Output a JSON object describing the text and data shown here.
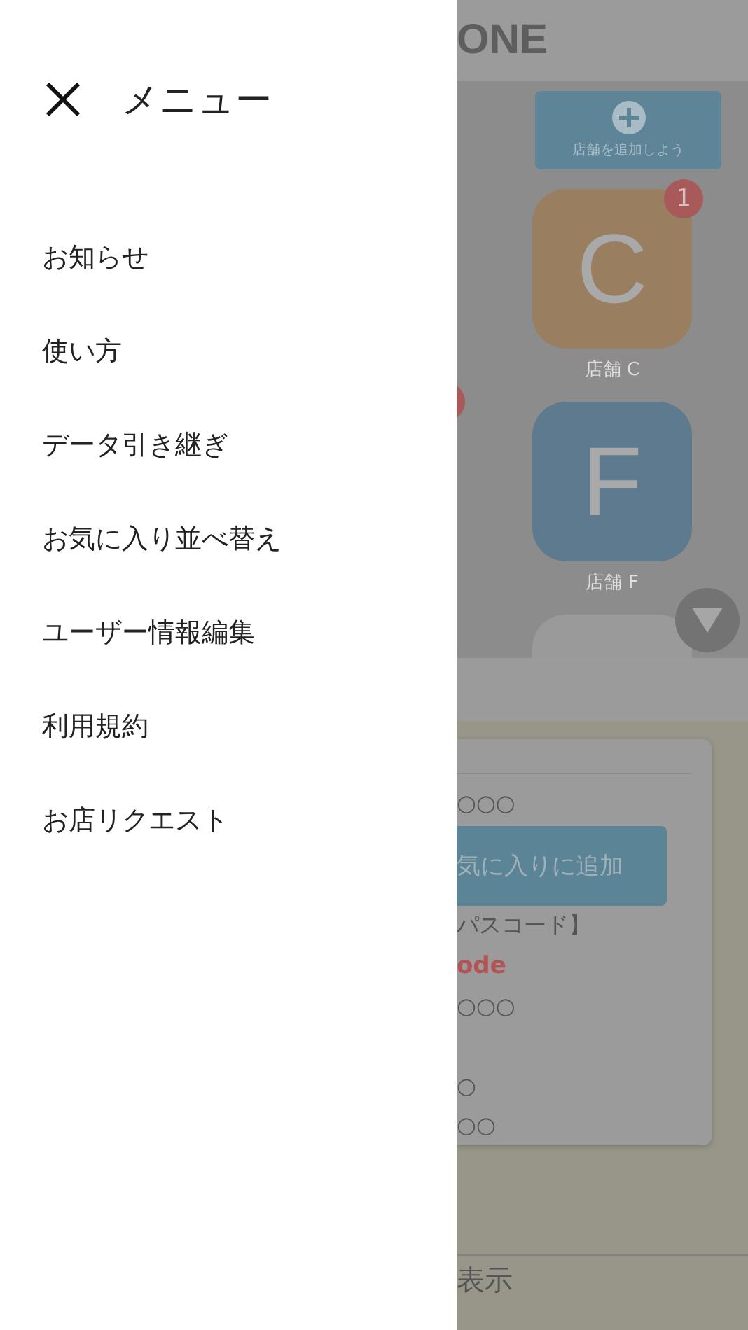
{
  "menu": {
    "title": "メニュー",
    "items": [
      "お知らせ",
      "使い方",
      "データ引き継ぎ",
      "お気に入り並べ替え",
      "ユーザー情報編集",
      "利用規約",
      "お店リクエスト"
    ]
  },
  "background": {
    "header_title": "ONE",
    "add_store_button": "店舗を追加しよう",
    "stores": [
      {
        "letter": "C",
        "name": "店舗 C",
        "badge": "1",
        "color": "#9a7e60"
      },
      {
        "letter": "F",
        "name": "店舗 F",
        "color": "#5e7a8e"
      },
      {
        "color": "#9a9a9a"
      }
    ],
    "card": {
      "items": [
        {
          "kind": "text",
          "text": "○○○"
        },
        {
          "kind": "button",
          "text": "気に入りに追加"
        },
        {
          "kind": "text",
          "text": "パスコード】"
        },
        {
          "kind": "code",
          "text": "ode"
        },
        {
          "kind": "text",
          "text": "○○○"
        },
        {
          "kind": "text",
          "text": "○"
        },
        {
          "kind": "text",
          "text": "○○"
        }
      ]
    },
    "footer": "表示"
  }
}
